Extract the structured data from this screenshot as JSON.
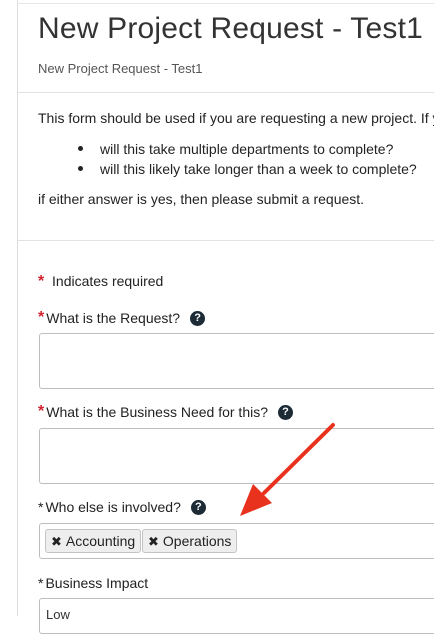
{
  "page": {
    "title": "New Project Request - Test1",
    "subtitle": "New Project Request - Test1"
  },
  "intro": {
    "text": "This form should be used if you are requesting a new project. If you",
    "bullets": [
      "will this take multiple departments to complete?",
      "will this likely take longer than a week to complete?"
    ],
    "closing": "if either answer is yes, then please submit a request."
  },
  "form": {
    "required_note": "Indicates required",
    "required_star": "*",
    "fields": {
      "request": {
        "label": "What is the Request?",
        "value": ""
      },
      "business_need": {
        "label": "What is the Business Need for this?",
        "value": ""
      },
      "involved": {
        "label": "Who else is involved?",
        "tags": [
          "Accounting",
          "Operations"
        ]
      },
      "business_impact": {
        "label": "Business Impact",
        "selected": "Low"
      }
    }
  },
  "icons": {
    "help": "help-icon",
    "tag_remove": "close-icon",
    "annotation": "arrow-icon"
  },
  "colors": {
    "required": "#d2222d",
    "help_icon": "#1d2b36",
    "annotation_arrow": "#e8321e"
  }
}
